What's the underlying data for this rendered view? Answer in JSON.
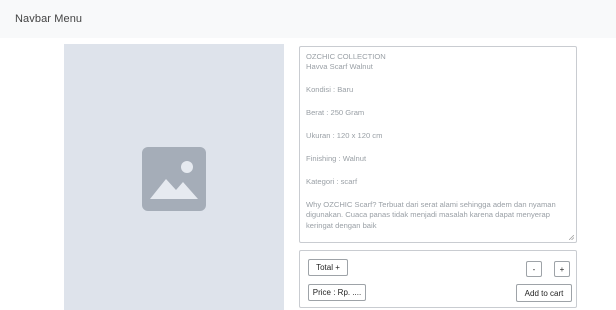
{
  "navbar": {
    "title": "Navbar Menu"
  },
  "product_image": {
    "icon": "image-icon",
    "background": "#dee3eb",
    "icon_color": "#a5adb8"
  },
  "description": {
    "lines": [
      "OZCHIC COLLECTION",
      "Havva Scarf Walnut",
      "Kondisi : Baru",
      "Berat : 250 Gram",
      "Ukuran : 120 x 120 cm",
      "Finishing : Walnut",
      "Kategori : scarf",
      "Why OZCHIC Scarf? Terbuat dari serat alami sehingga adem dan nyaman digunakan. Cuaca panas tidak menjadi masalah karena dapat menyerap keringat dengan baik"
    ]
  },
  "actions": {
    "total_label": "Total +",
    "minus_label": "-",
    "plus_label": "+",
    "price_label": "Price : Rp. ....",
    "add_to_cart_label": "Add to cart"
  }
}
